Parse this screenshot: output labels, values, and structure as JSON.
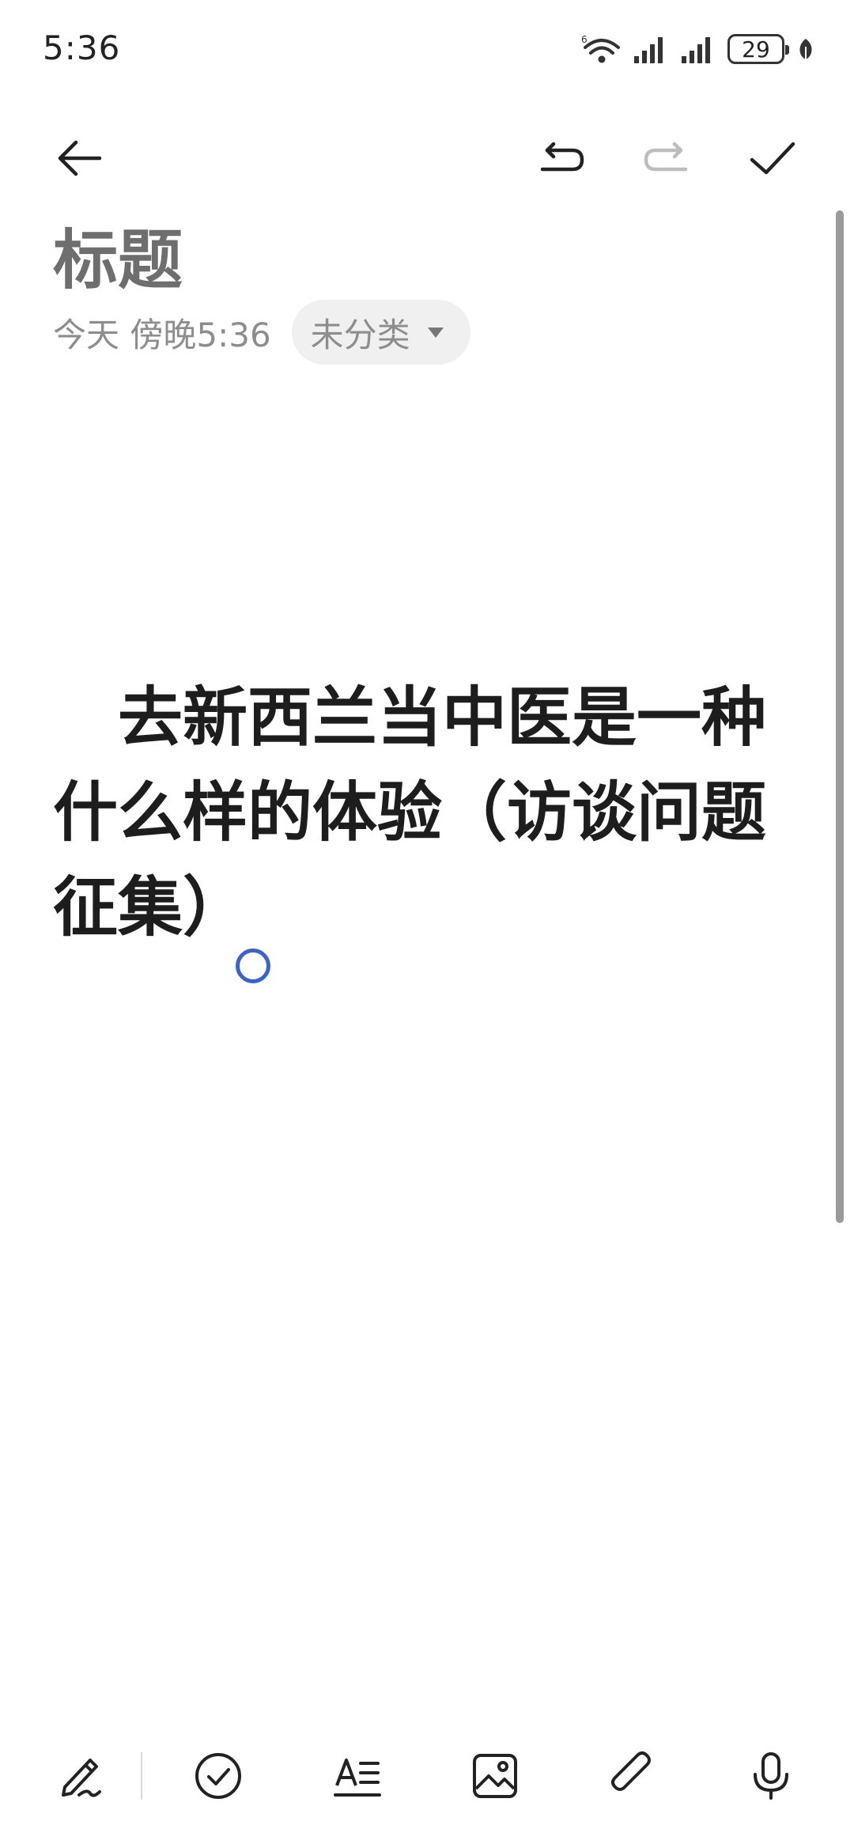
{
  "status_bar": {
    "time": "5:36",
    "network_badge": "6",
    "battery_level": "29"
  },
  "toolbar": {
    "icons": [
      "back-arrow-icon",
      "undo-icon",
      "redo-icon",
      "checkmark-icon"
    ],
    "redo_enabled": false
  },
  "note": {
    "title_placeholder": "标题",
    "date": "今天 傍晚5:36",
    "category": "未分类",
    "body": "　去新西兰当中医是一种什么样的体验（访谈问题征集）"
  },
  "bottom_bar": {
    "icons": [
      "handwriting-pen-icon",
      "checklist-icon",
      "text-format-icon",
      "image-icon",
      "attachment-icon",
      "microphone-icon"
    ]
  },
  "colors": {
    "cursor_handle": "#3a62c8",
    "chip_background": "#f0f0f0",
    "title_placeholder": "#6e6e6e",
    "meta_text": "#8d8d8d",
    "body_text": "#1d1d1d",
    "disabled_icon": "#bdbdbd"
  }
}
